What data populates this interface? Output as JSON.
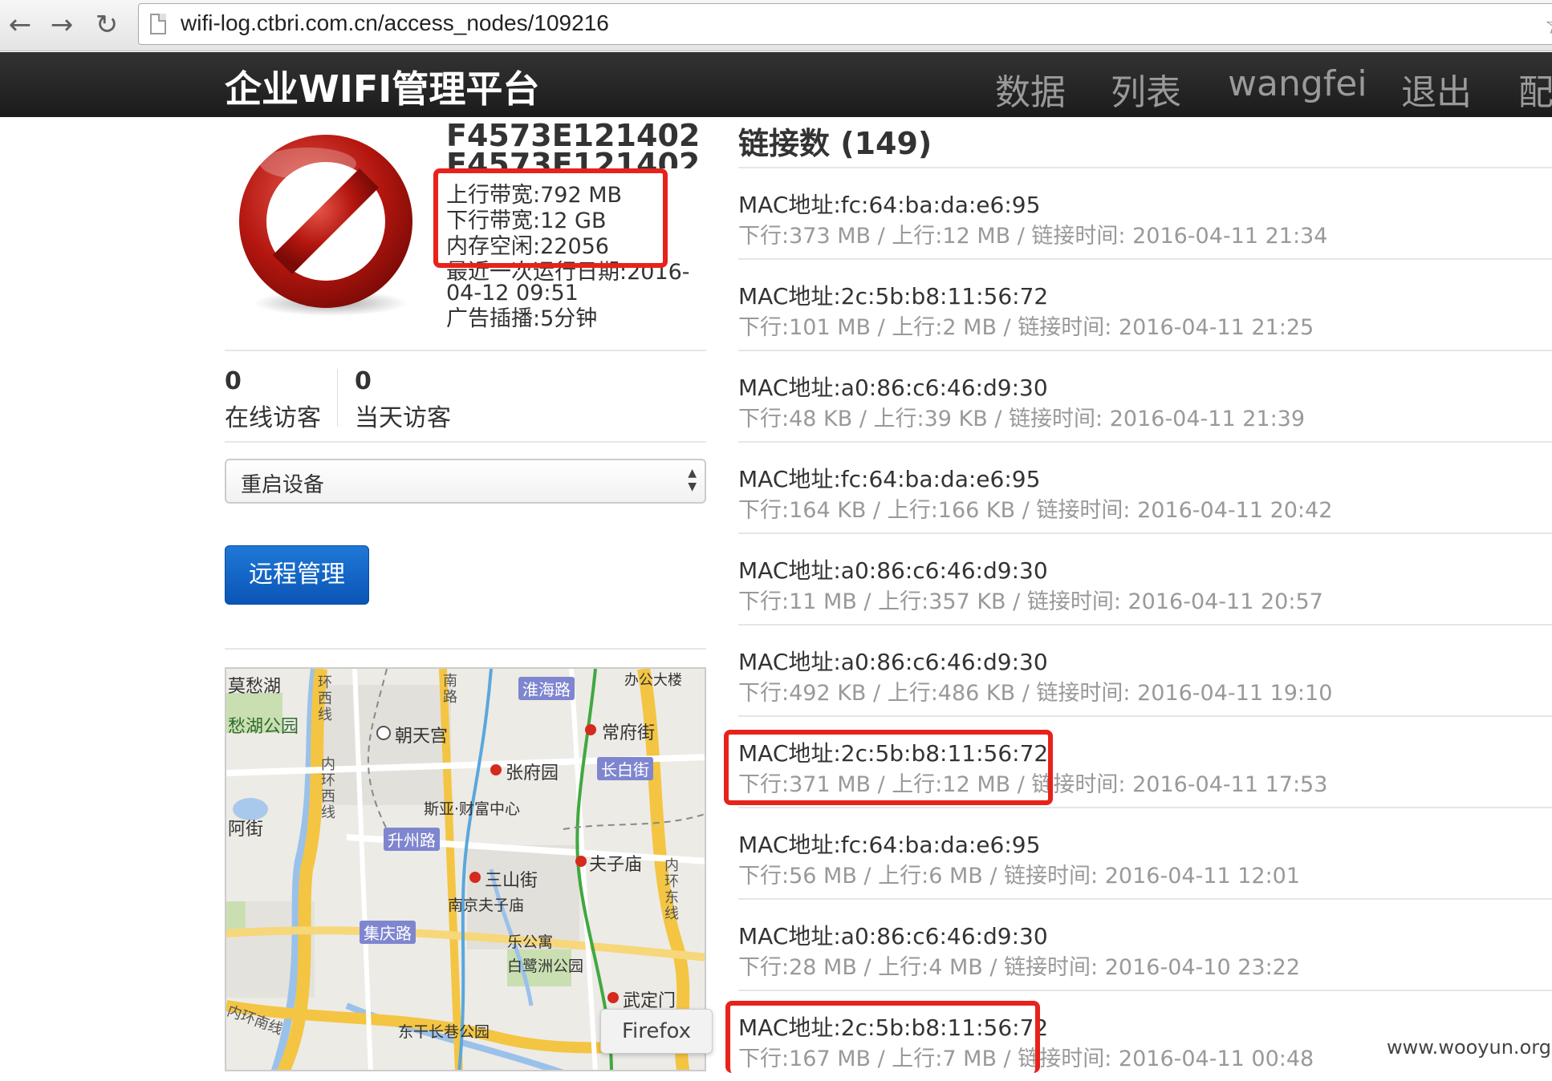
{
  "browser": {
    "url": "wifi-log.ctbri.com.cn/access_nodes/109216",
    "back_icon": "arrow-left-icon",
    "forward_icon": "arrow-right-icon",
    "reload_icon": "reload-icon",
    "bookmark_icon": "star-icon"
  },
  "navbar": {
    "brand": "企业WIFI管理平台",
    "items": [
      "数据",
      "列表",
      "wangfei",
      "退出",
      "配"
    ]
  },
  "device": {
    "icon": "no-entry-icon",
    "title": "F4573E121402",
    "title_overlap": "F4573E121402",
    "upload": "上行带宽:792 MB",
    "download": "下行带宽:12 GB",
    "memory": "内存空闲:22056",
    "last_run_line1": "最近一次运行日期:2016-",
    "last_run_line2": "04-12 09:51",
    "ad_interval": "广告插播:5分钟"
  },
  "stats": {
    "online_count": "0",
    "online_label": "在线访客",
    "today_count": "0",
    "today_label": "当天访客"
  },
  "action_select": {
    "selected": "重启设备"
  },
  "remote_button": "远程管理",
  "map": {
    "labels": [
      "莫愁湖",
      "愁湖公园",
      "朝天宫",
      "常府街",
      "张府园",
      "斯亚·财富中心",
      "三山街",
      "夫子庙",
      "南京夫子庙",
      "乐公寓",
      "白鹭洲公园",
      "武定门",
      "东干长巷公园",
      "阿街",
      "办公大楼"
    ],
    "road_tags": [
      "淮海路",
      "长白街",
      "升州路",
      "集庆路"
    ],
    "vertical_labels": [
      "环西线",
      "内环西线",
      "内环东线",
      "南路",
      "内环南线"
    ],
    "tooltip": "Firefox"
  },
  "connections": {
    "title": "链接数 (149)",
    "rows": [
      {
        "mac": "MAC地址:fc:64:ba:da:e6:95",
        "detail": "下行:373 MB / 上行:12 MB / 链接时间: 2016-04-11 21:34"
      },
      {
        "mac": "MAC地址:2c:5b:b8:11:56:72",
        "detail": "下行:101 MB / 上行:2 MB / 链接时间: 2016-04-11 21:25"
      },
      {
        "mac": "MAC地址:a0:86:c6:46:d9:30",
        "detail": "下行:48 KB / 上行:39 KB / 链接时间: 2016-04-11 21:39"
      },
      {
        "mac": "MAC地址:fc:64:ba:da:e6:95",
        "detail": "下行:164 KB / 上行:166 KB / 链接时间: 2016-04-11 20:42"
      },
      {
        "mac": "MAC地址:a0:86:c6:46:d9:30",
        "detail": "下行:11 MB / 上行:357 KB / 链接时间: 2016-04-11 20:57"
      },
      {
        "mac": "MAC地址:a0:86:c6:46:d9:30",
        "detail": "下行:492 KB / 上行:486 KB / 链接时间: 2016-04-11 19:10"
      },
      {
        "mac": "MAC地址:2c:5b:b8:11:56:72",
        "detail": "下行:371 MB / 上行:12 MB / 链接时间: 2016-04-11 17:53"
      },
      {
        "mac": "MAC地址:fc:64:ba:da:e6:95",
        "detail": "下行:56 MB / 上行:6 MB / 链接时间: 2016-04-11 12:01"
      },
      {
        "mac": "MAC地址:a0:86:c6:46:d9:30",
        "detail": "下行:28 MB / 上行:4 MB / 链接时间: 2016-04-10 23:22"
      },
      {
        "mac": "MAC地址:2c:5b:b8:11:56:72",
        "detail": "下行:167 MB / 上行:7 MB / 链接时间: 2016-04-11 00:48"
      }
    ]
  },
  "watermark": "www.wooyun.org",
  "colors": {
    "highlight": "#e8221b",
    "navbar": "#222222",
    "primary_button": "#0a55b6"
  }
}
